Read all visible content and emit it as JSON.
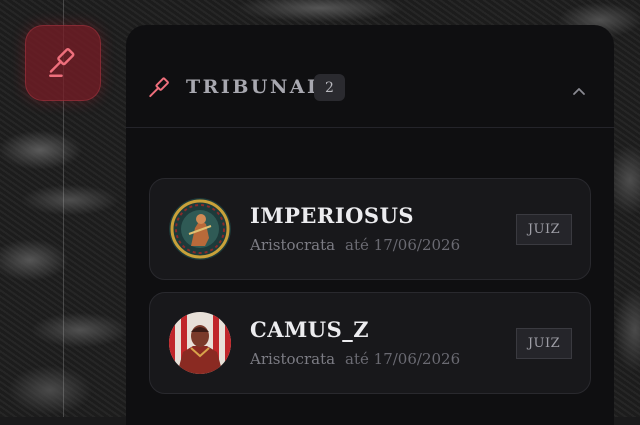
{
  "panel": {
    "title": "TRIBUNAL",
    "count": "2"
  },
  "icons": {
    "fab": "gavel-icon",
    "header": "gavel-icon",
    "collapse": "chevron-up-icon"
  },
  "colors": {
    "accent": "#ef6f7c",
    "fab_bg": "#7a1c26",
    "panel_bg": "#0f0f11",
    "card_bg": "#18181b"
  },
  "members": [
    {
      "name": "IMPERIOSUS",
      "rank": "Aristocrata",
      "until": "até 17/06/2026",
      "role": "JUIZ"
    },
    {
      "name": "CAMUS_Z",
      "rank": "Aristocrata",
      "until": "até 17/06/2026",
      "role": "JUIZ"
    }
  ]
}
